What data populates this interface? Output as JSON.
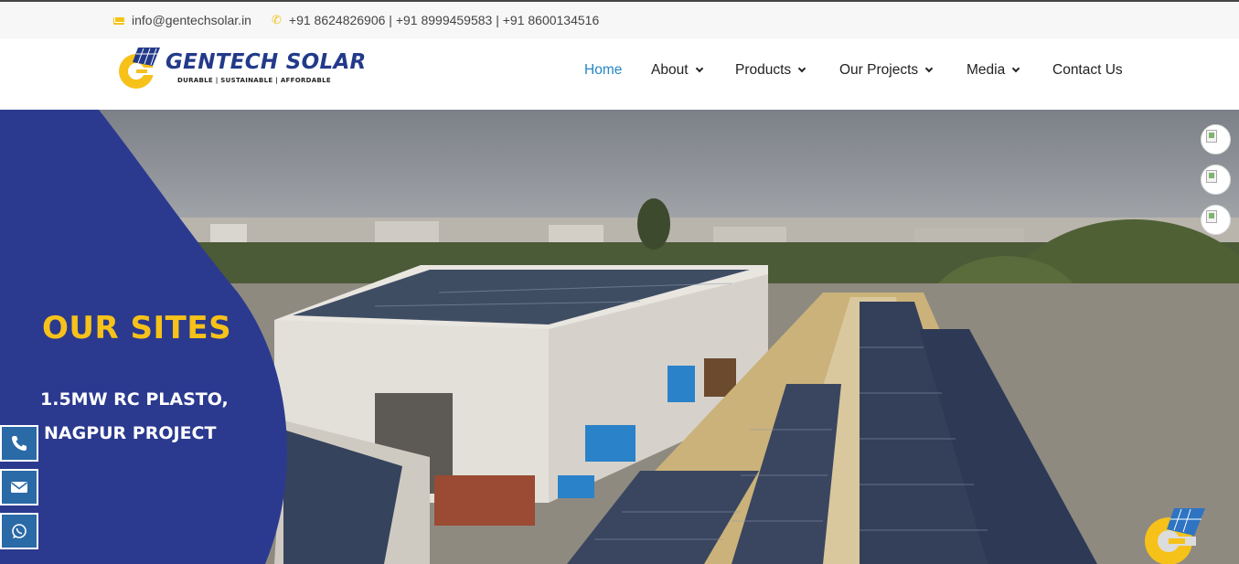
{
  "topbar": {
    "email": "info@gentechsolar.in",
    "phones": "+91 8624826906 | +91 8999459583 | +91 8600134516",
    "email_icon": "envelope-icon",
    "phone_icon": "phone-icon"
  },
  "brand": {
    "name": "GENTECH SOLAR",
    "tagline": "DURABLE  |  SUSTAINABLE  |  AFFORDABLE",
    "primary_color": "#233a8a",
    "accent_color": "#f6c21a"
  },
  "nav": {
    "items": [
      {
        "label": "Home",
        "active": true
      },
      {
        "label": "About",
        "dropdown": true
      },
      {
        "label": "Products",
        "dropdown": true
      },
      {
        "label": "Our Projects",
        "dropdown": true
      },
      {
        "label": "Media",
        "dropdown": true
      },
      {
        "label": "Contact Us"
      }
    ],
    "active_color": "#2687c4"
  },
  "hero": {
    "title": "OUR SITES",
    "subtitle_line1": "1.5MW RC PLASTO,",
    "subtitle_line2": "NAGPUR PROJECT",
    "panel_color": "#2b3a8f"
  },
  "floating_actions": [
    {
      "icon": "phone-icon"
    },
    {
      "icon": "envelope-icon"
    },
    {
      "icon": "whatsapp-icon"
    }
  ],
  "social_links": [
    {
      "icon": "broken-image-icon"
    },
    {
      "icon": "broken-image-icon"
    },
    {
      "icon": "broken-image-icon"
    }
  ]
}
